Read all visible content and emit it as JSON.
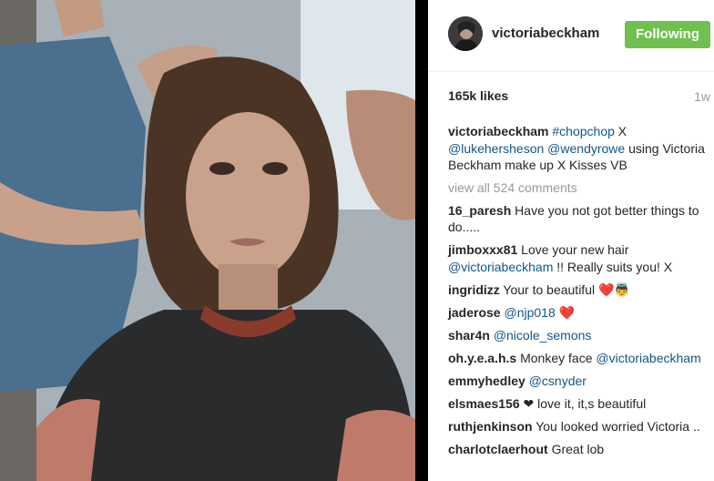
{
  "post": {
    "username": "victoriabeckham",
    "follow_label": "Following",
    "likes": "165k likes",
    "time": "1w",
    "caption": {
      "user": "victoriabeckham",
      "tag1": "#chopchop",
      "text1": " X ",
      "tag2": "@lukehersheson",
      "text2": " ",
      "tag3": "@wendyrowe",
      "text3": " using Victoria Beckham make up X Kisses VB"
    },
    "view_all": "view all 524 comments"
  },
  "comments": [
    {
      "user": "16_paresh",
      "text": " Have you not got better things to do....."
    },
    {
      "user": "jimboxxx81",
      "text": " Love your new hair ",
      "tag": "@victoriabeckham",
      "text2": " !! Really suits you! X"
    },
    {
      "user": "ingridizz",
      "text": " Your to beautiful ",
      "emoji": "❤️👼"
    },
    {
      "user": "jaderose",
      "text": " ",
      "tag": "@njp018",
      "emoji": " ❤️"
    },
    {
      "user": "shar4n",
      "text": " ",
      "tag": "@nicole_semons"
    },
    {
      "user": "oh.y.e.a.h.s",
      "text": " Monkey face ",
      "tag": "@victoriabeckham"
    },
    {
      "user": "emmyhedley",
      "text": " ",
      "tag": "@csnyder"
    },
    {
      "user": "elsmaes156",
      "text": " ❤ love it, it,s beautiful"
    },
    {
      "user": "ruthjenkinson",
      "text": " You looked worried Victoria .."
    },
    {
      "user": "charlotclaerhout",
      "text": " Great lob"
    }
  ],
  "icons": {
    "avatar": "profile-avatar"
  }
}
